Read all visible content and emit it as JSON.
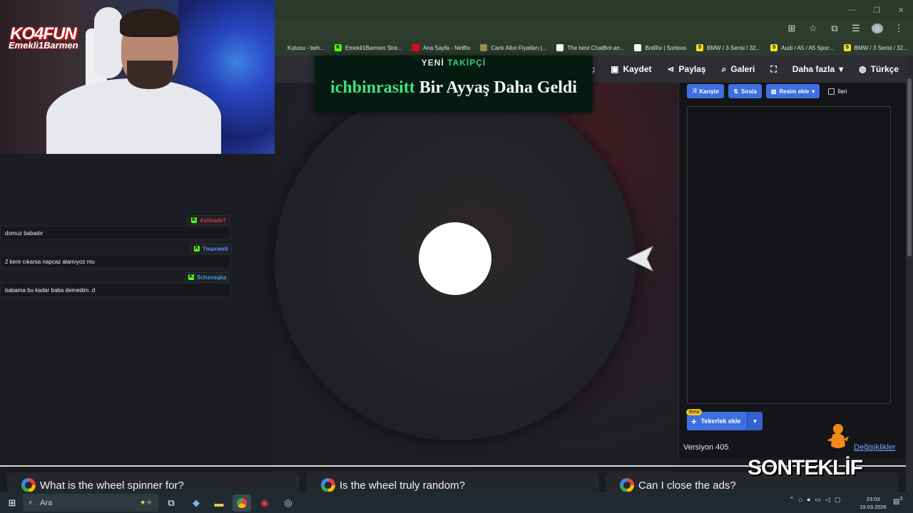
{
  "browser": {
    "bookmarks": [
      {
        "label": "Kutusu - beh...",
        "icon": "",
        "color": "#2c3b2d"
      },
      {
        "label": "Emekli1Barmen Stre...",
        "icon": "K",
        "color": "#53fc18"
      },
      {
        "label": "Ana Sayfa - Netflix",
        "icon": "",
        "color": "#e50914"
      },
      {
        "label": "Canlı Altın Fiyatları |...",
        "icon": "",
        "color": "#9a8a5a"
      },
      {
        "label": "The best ChatBot an...",
        "icon": "",
        "color": "#ffffff"
      },
      {
        "label": "BotRix | Sorteos",
        "icon": "",
        "color": "#ffffff"
      },
      {
        "label": "BMW / 3 Serisi / 32...",
        "icon": "S",
        "color": "#f5e12a"
      },
      {
        "label": "Audi / A5 / A5 Spor...",
        "icon": "S",
        "color": "#f5e12a"
      },
      {
        "label": "BMW / 3 Serisi / 32...",
        "icon": "S",
        "color": "#f5e12a"
      }
    ],
    "more_bookmarks": "»",
    "avatar_letter": "a"
  },
  "nav": {
    "open": "Aç",
    "save": "Kaydet",
    "share": "Paylaş",
    "gallery": "Galeri",
    "more": "Daha fazla",
    "language": "Türkçe"
  },
  "panel": {
    "shuffle": "Karıştır",
    "sort": "Sırala",
    "add_image": "Resim ekle",
    "advanced": "İleri",
    "beta": "Beta",
    "add_wheel": "Tekerlek ekle",
    "version": "Versiyon 405",
    "changes": "Değişiklikler"
  },
  "faq": {
    "q1": "What is the wheel spinner for?",
    "q2": "Is the wheel truly random?",
    "q3": "Can I close the ads?"
  },
  "overlay": {
    "logo_main": "KO4FUN",
    "logo_sub": "Emekli1Barmen",
    "follow_title_a": "YENİ",
    "follow_title_b": "TAKİPÇİ",
    "follow_user": "ichbinrasitt",
    "follow_msg": "Bir Ayyaş Daha Geldi",
    "sponsor": "SONTEKLİF"
  },
  "chat": [
    {
      "user": "Aslizade7",
      "color": "#e0304a",
      "message": "domuz babadır"
    },
    {
      "user": "7maxwell",
      "color": "#5a8cff",
      "message": "2 kere cıkarsa napcaz alamıyoz mu"
    },
    {
      "user": "Schzeaqka",
      "color": "#3aa0e0",
      "message": "babama bu kadar baba demedim .d"
    }
  ],
  "taskbar": {
    "search": "Ara",
    "time": "23:03",
    "date": "19.03.2026",
    "notifications": "3"
  }
}
